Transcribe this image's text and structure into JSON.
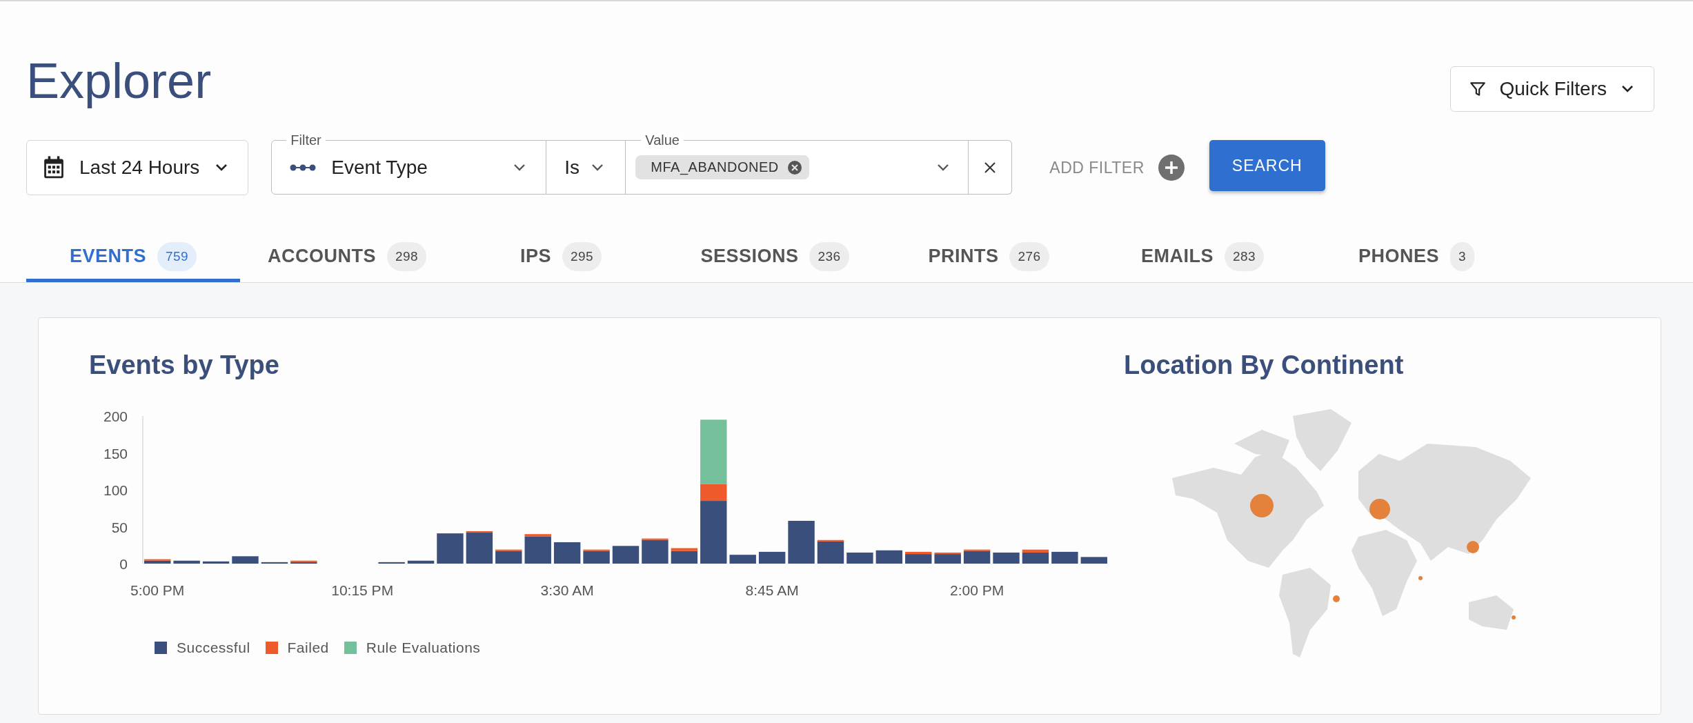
{
  "page": {
    "title": "Explorer"
  },
  "quick_filters": {
    "label": "Quick Filters"
  },
  "date_range": {
    "value": "Last 24 Hours"
  },
  "filter": {
    "field_label": "Filter",
    "field": "Event Type",
    "operator": "Is",
    "value_label": "Value",
    "chips": [
      "MFA_ABANDONED"
    ]
  },
  "add_filter": {
    "label": "ADD FILTER"
  },
  "search_button": {
    "label": "SEARCH"
  },
  "tabs": [
    {
      "label": "EVENTS",
      "count": "759",
      "selected": true
    },
    {
      "label": "ACCOUNTS",
      "count": "298",
      "selected": false
    },
    {
      "label": "IPS",
      "count": "295",
      "selected": false
    },
    {
      "label": "SESSIONS",
      "count": "236",
      "selected": false
    },
    {
      "label": "PRINTS",
      "count": "276",
      "selected": false
    },
    {
      "label": "EMAILS",
      "count": "283",
      "selected": false
    },
    {
      "label": "PHONES",
      "count": "3",
      "selected": false
    }
  ],
  "events_chart": {
    "title": "Events by Type",
    "chart_data": {
      "type": "bar",
      "stacked": true,
      "legend": "bottom",
      "ylim": [
        0,
        200
      ],
      "yticks": [
        0,
        50,
        100,
        150,
        200
      ],
      "categories": [
        "5:00 PM",
        null,
        null,
        null,
        null,
        null,
        null,
        "10:15 PM",
        null,
        null,
        null,
        null,
        null,
        null,
        "3:30 AM",
        null,
        null,
        null,
        null,
        null,
        null,
        "8:45 AM",
        null,
        null,
        null,
        null,
        null,
        null,
        "2:00 PM",
        null,
        null,
        null,
        null
      ],
      "series": [
        {
          "name": "Successful",
          "color": "#3b4f7c",
          "values": [
            4,
            4,
            3,
            10,
            2,
            2,
            0,
            0,
            2,
            4,
            41,
            42,
            17,
            37,
            29,
            17,
            24,
            32,
            17,
            85,
            12,
            16,
            58,
            30,
            15,
            18,
            13,
            13,
            17,
            15,
            15,
            16,
            9
          ]
        },
        {
          "name": "Failed",
          "color": "#ee5a2c",
          "values": [
            2,
            0,
            0,
            0,
            0,
            2,
            0,
            0,
            0,
            0,
            0,
            2,
            2,
            3,
            0,
            2,
            0,
            2,
            4,
            23,
            0,
            0,
            0,
            2,
            0,
            0,
            3,
            2,
            2,
            0,
            4,
            0,
            0
          ]
        },
        {
          "name": "Rule Evaluations",
          "color": "#74c09a",
          "values": [
            0,
            0,
            0,
            0,
            0,
            0,
            0,
            0,
            0,
            0,
            0,
            0,
            0,
            0,
            0,
            0,
            0,
            0,
            0,
            87,
            0,
            0,
            0,
            0,
            0,
            0,
            0,
            0,
            0,
            0,
            0,
            0,
            0
          ]
        }
      ]
    }
  },
  "location_map": {
    "title": "Location By Continent"
  }
}
